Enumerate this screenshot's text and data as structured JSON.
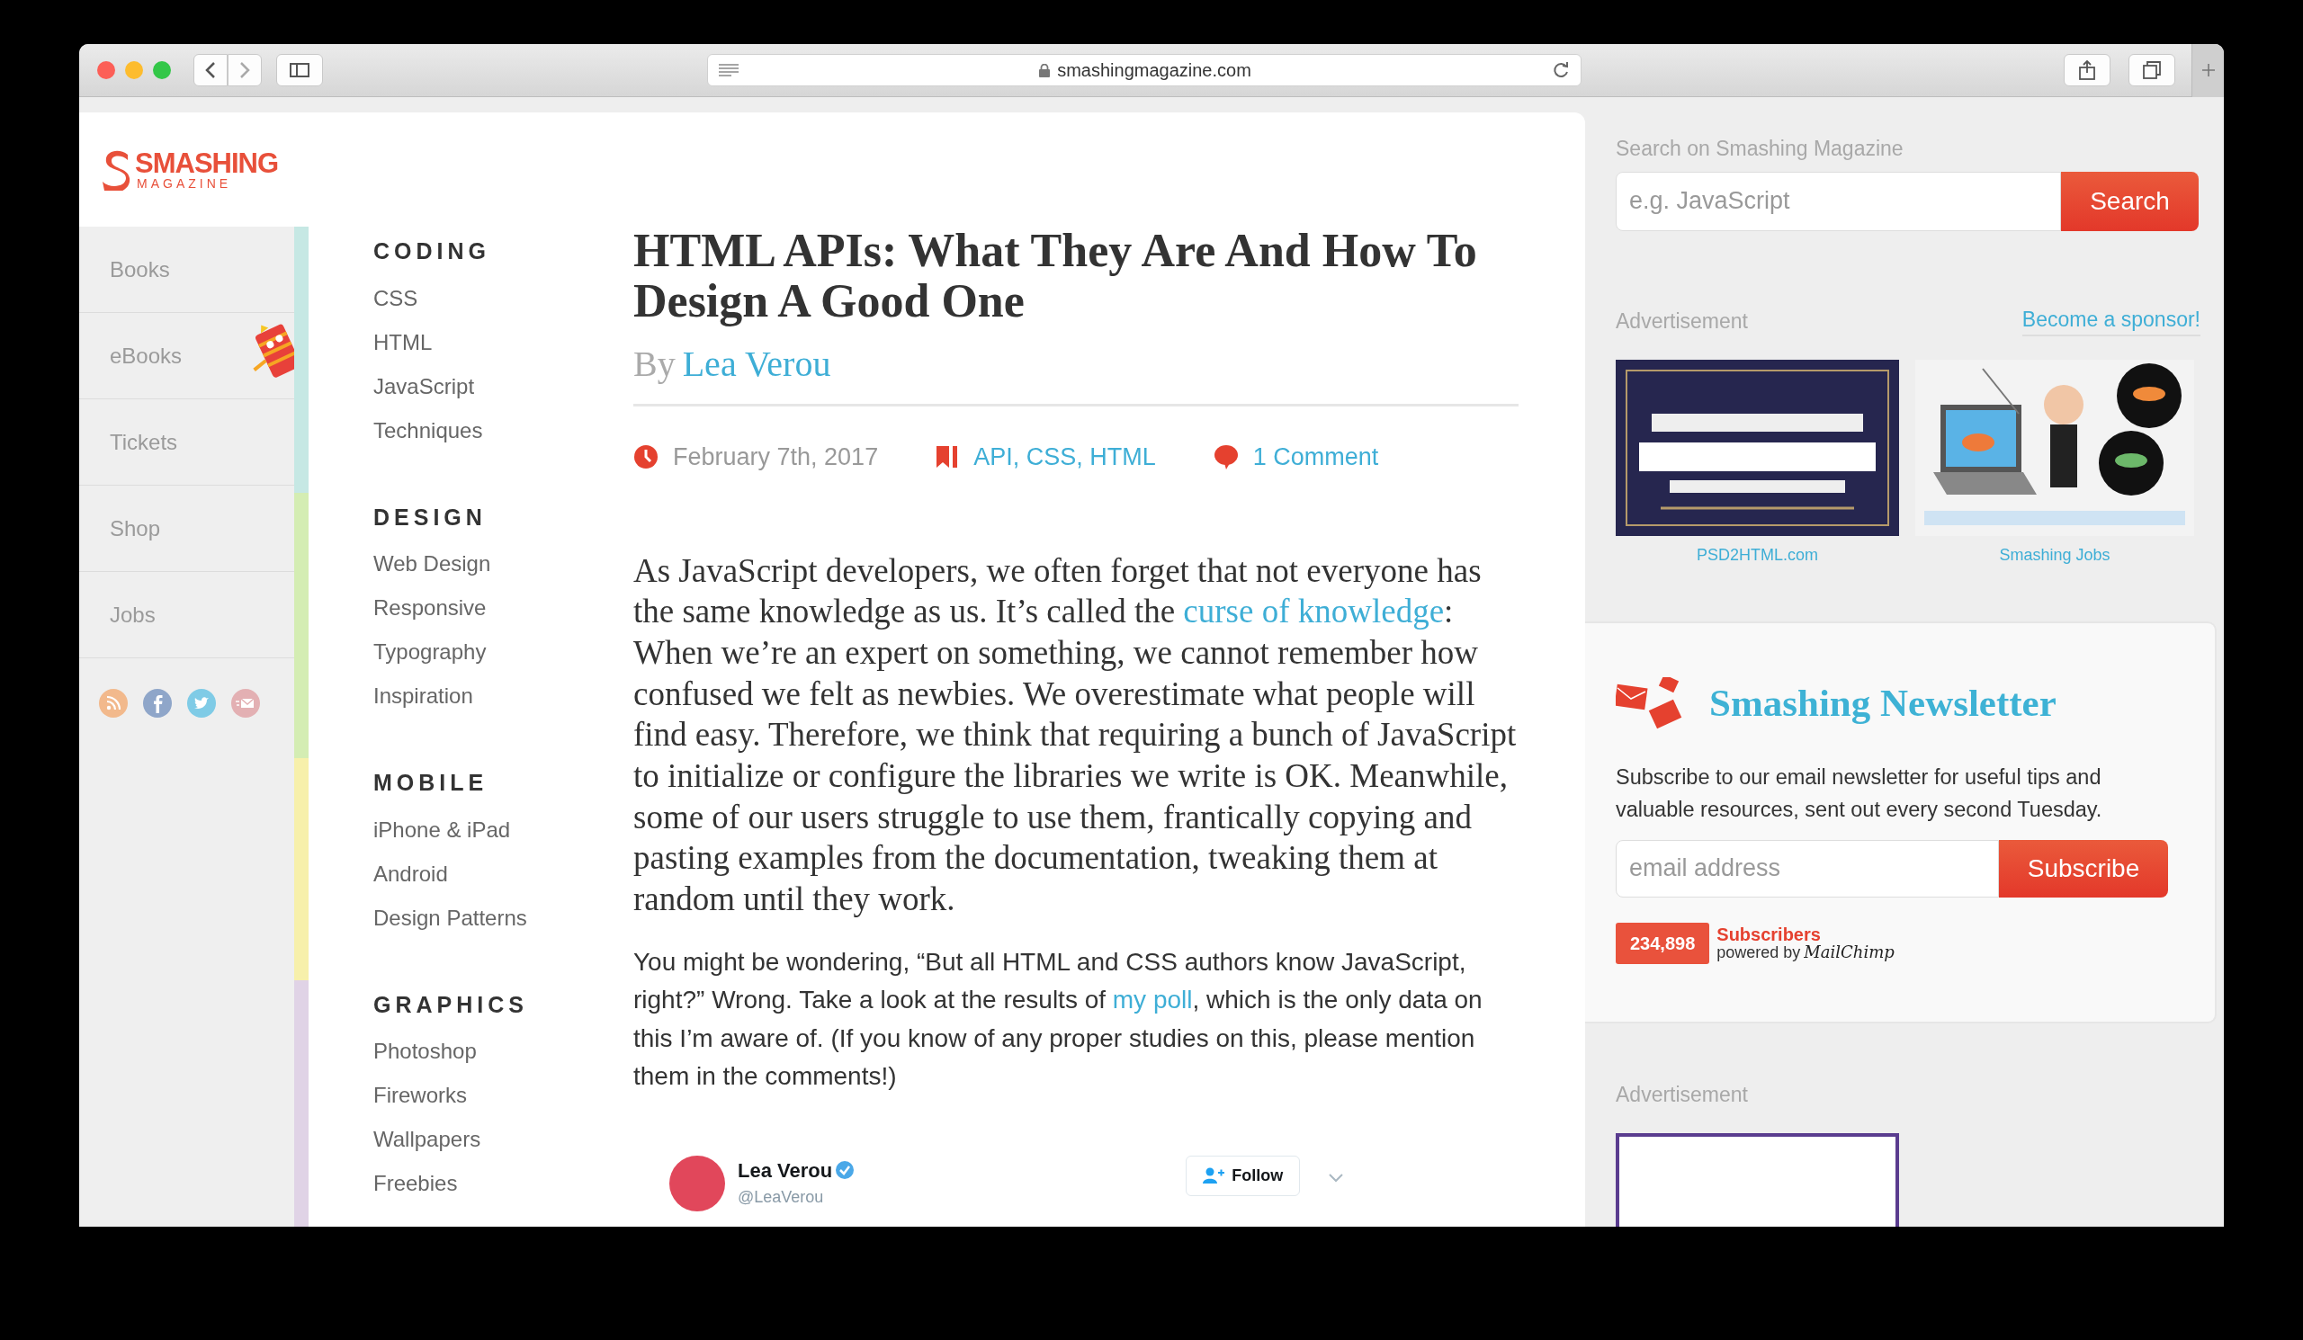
{
  "browser": {
    "url": "smashingmagazine.com"
  },
  "logo": {
    "name": "SMASHING",
    "tagline": "MAGAZINE"
  },
  "sidebar": {
    "items": [
      {
        "label": "Books"
      },
      {
        "label": "eBooks"
      },
      {
        "label": "Tickets"
      },
      {
        "label": "Shop"
      },
      {
        "label": "Jobs"
      }
    ]
  },
  "categories": [
    {
      "title": "CODING",
      "color": "#c6e8e4",
      "links": [
        "CSS",
        "HTML",
        "JavaScript",
        "Techniques"
      ]
    },
    {
      "title": "DESIGN",
      "color": "#d4edb3",
      "links": [
        "Web Design",
        "Responsive",
        "Typography",
        "Inspiration"
      ]
    },
    {
      "title": "MOBILE",
      "color": "#f7f0ab",
      "links": [
        "iPhone & iPad",
        "Android",
        "Design Patterns"
      ]
    },
    {
      "title": "GRAPHICS",
      "color": "#e0d3e6",
      "links": [
        "Photoshop",
        "Fireworks",
        "Wallpapers",
        "Freebies"
      ]
    }
  ],
  "article": {
    "title": "HTML APIs: What They Are And How To Design A Good One",
    "byline_prefix": "By",
    "author": "Lea Verou",
    "date": "February 7th, 2017",
    "tags": "API, CSS, HTML",
    "comments": "1 Comment",
    "paragraphs": [
      {
        "kind": "lead",
        "segments": [
          {
            "kind": "text",
            "text": "As JavaScript developers, we often forget that not everyone has the same knowledge as us. It’s called the "
          },
          {
            "kind": "link",
            "text": "curse of knowledge"
          },
          {
            "kind": "text",
            "text": ": When we’re an expert on something, we cannot remember how confused we felt as newbies. We overestimate what people will find easy. Therefore, we think that requiring a bunch of JavaScript to initialize or configure the libraries we write is OK. Meanwhile, some of our users struggle to use them, frantically copying and pasting examples from the documentation, tweaking them at random until they work."
          }
        ]
      },
      {
        "kind": "body",
        "segments": [
          {
            "kind": "text",
            "text": "You might be wondering, “But all HTML and CSS authors know JavaScript, right?” Wrong. Take a look at the results of "
          },
          {
            "kind": "link",
            "text": "my poll"
          },
          {
            "kind": "text",
            "text": ", which is the only data on this I’m aware of. (If you know of any proper studies on this, please mention them in the comments!)"
          }
        ]
      }
    ],
    "tweet": {
      "name": "Lea Verou",
      "handle": "@LeaVerou",
      "verified": true,
      "follow": "Follow"
    }
  },
  "search": {
    "label": "Search on Smashing Magazine",
    "placeholder": "e.g. JavaScript",
    "button": "Search"
  },
  "ads": {
    "label": "Advertisement",
    "sponsor_link": "Become a sponsor!",
    "items": [
      {
        "kind": "psd",
        "caption": "PSD2HTML.com"
      },
      {
        "kind": "jobs",
        "caption": "Smashing Jobs"
      }
    ]
  },
  "newsletter": {
    "title": "Smashing Newsletter",
    "text": "Subscribe to our email newsletter for useful tips and valuable resources, sent out every second Tuesday.",
    "placeholder": "email address",
    "button": "Subscribe",
    "count": "234,898",
    "count_label": "Subscribers",
    "powered_by": "powered by",
    "provider": "MailChimp"
  },
  "ad_bottom": {
    "label": "Advertisement"
  }
}
